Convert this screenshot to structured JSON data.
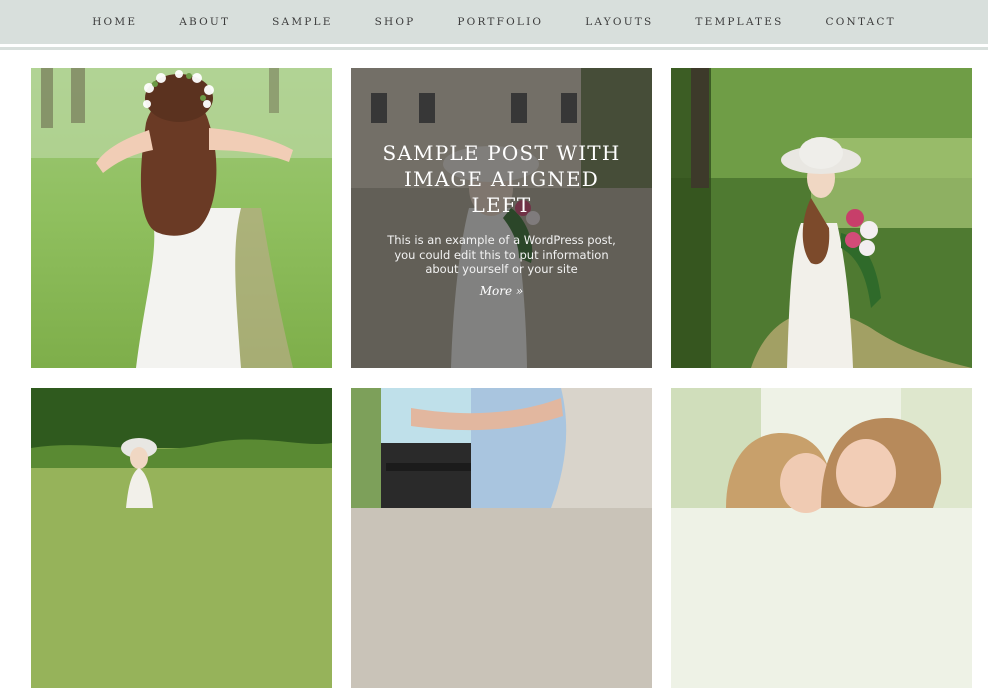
{
  "nav": {
    "items": [
      "HOME",
      "ABOUT",
      "SAMPLE",
      "SHOP",
      "PORTFOLIO",
      "LAYOUTS",
      "TEMPLATES",
      "CONTACT"
    ]
  },
  "featured": {
    "title": "SAMPLE POST WITH IMAGE ALIGNED LEFT",
    "excerpt": "This is an example of a WordPress post, you could edit this to put information about yourself or your site",
    "more": "More »"
  }
}
